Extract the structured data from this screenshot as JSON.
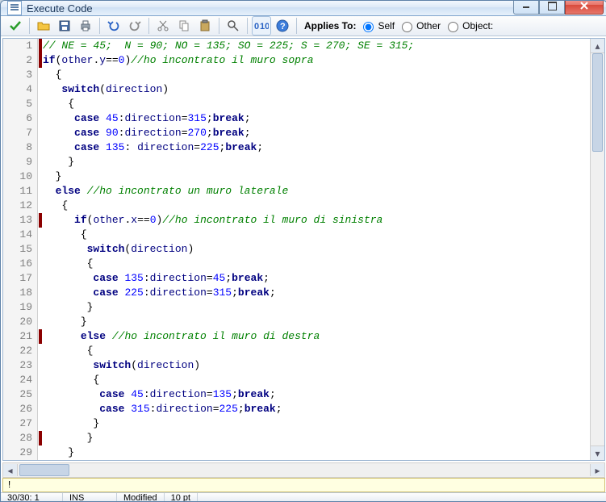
{
  "window": {
    "title": "Execute Code"
  },
  "toolbar": {
    "applies_label": "Applies To:",
    "opt_self": "Self",
    "opt_other": "Other",
    "opt_object": "Object:"
  },
  "applies_selected": "self",
  "code": {
    "lines": [
      {
        "n": 1,
        "mark": true,
        "html": "<span class='cm'>// NE = 45;  N = 90; NO = 135; SO = 225; S = 270; SE = 315;</span>"
      },
      {
        "n": 2,
        "mark": true,
        "html": "<span class='kw'>if</span><span class='op'>(</span><span class='var'>other</span>.<span class='var'>y</span>==<span class='num'>0</span><span class='op'>)</span><span class='cm'>//ho incontrato il muro sopra</span>"
      },
      {
        "n": 3,
        "mark": false,
        "html": "  <span class='op'>{</span>"
      },
      {
        "n": 4,
        "mark": false,
        "html": "   <span class='kw'>switch</span><span class='op'>(</span><span class='var'>direction</span><span class='op'>)</span>"
      },
      {
        "n": 5,
        "mark": false,
        "html": "    <span class='op'>{</span>"
      },
      {
        "n": 6,
        "mark": false,
        "html": "     <span class='kw'>case</span> <span class='num'>45</span>:<span class='var'>direction</span>=<span class='num'>315</span>;<span class='kw'>break</span>;"
      },
      {
        "n": 7,
        "mark": false,
        "html": "     <span class='kw'>case</span> <span class='num'>90</span>:<span class='var'>direction</span>=<span class='num'>270</span>;<span class='kw'>break</span>;"
      },
      {
        "n": 8,
        "mark": false,
        "html": "     <span class='kw'>case</span> <span class='num'>135</span>: <span class='var'>direction</span>=<span class='num'>225</span>;<span class='kw'>break</span>;"
      },
      {
        "n": 9,
        "mark": false,
        "html": "    <span class='op'>}</span>"
      },
      {
        "n": 10,
        "mark": false,
        "html": "  <span class='op'>}</span>"
      },
      {
        "n": 11,
        "mark": false,
        "html": "  <span class='kw'>else</span> <span class='cm'>//ho incontrato un muro laterale</span>"
      },
      {
        "n": 12,
        "mark": false,
        "html": "   <span class='op'>{</span>"
      },
      {
        "n": 13,
        "mark": true,
        "html": "     <span class='kw'>if</span><span class='op'>(</span><span class='var'>other</span>.<span class='var'>x</span>==<span class='num'>0</span><span class='op'>)</span><span class='cm'>//ho incontrato il muro di sinistra</span>"
      },
      {
        "n": 14,
        "mark": false,
        "html": "      <span class='op'>{</span>"
      },
      {
        "n": 15,
        "mark": false,
        "html": "       <span class='kw'>switch</span><span class='op'>(</span><span class='var'>direction</span><span class='op'>)</span>"
      },
      {
        "n": 16,
        "mark": false,
        "html": "       <span class='op'>{</span>"
      },
      {
        "n": 17,
        "mark": false,
        "html": "        <span class='kw'>case</span> <span class='num'>135</span>:<span class='var'>direction</span>=<span class='num'>45</span>;<span class='kw'>break</span>;"
      },
      {
        "n": 18,
        "mark": false,
        "html": "        <span class='kw'>case</span> <span class='num'>225</span>:<span class='var'>direction</span>=<span class='num'>315</span>;<span class='kw'>break</span>;"
      },
      {
        "n": 19,
        "mark": false,
        "html": "       <span class='op'>}</span>"
      },
      {
        "n": 20,
        "mark": false,
        "html": "      <span class='op'>}</span>"
      },
      {
        "n": 21,
        "mark": true,
        "html": "      <span class='kw'>else</span> <span class='cm'>//ho incontrato il muro di destra</span>"
      },
      {
        "n": 22,
        "mark": false,
        "html": "       <span class='op'>{</span>"
      },
      {
        "n": 23,
        "mark": false,
        "html": "        <span class='kw'>switch</span><span class='op'>(</span><span class='var'>direction</span><span class='op'>)</span>"
      },
      {
        "n": 24,
        "mark": false,
        "html": "        <span class='op'>{</span>"
      },
      {
        "n": 25,
        "mark": false,
        "html": "         <span class='kw'>case</span> <span class='num'>45</span>:<span class='var'>direction</span>=<span class='num'>135</span>;<span class='kw'>break</span>;"
      },
      {
        "n": 26,
        "mark": false,
        "html": "         <span class='kw'>case</span> <span class='num'>315</span>:<span class='var'>direction</span>=<span class='num'>225</span>;<span class='kw'>break</span>;"
      },
      {
        "n": 27,
        "mark": false,
        "html": "        <span class='op'>}</span>"
      },
      {
        "n": 28,
        "mark": true,
        "html": "       <span class='op'>}</span>"
      },
      {
        "n": 29,
        "mark": false,
        "html": "    <span class='op'>}</span>"
      }
    ]
  },
  "error_bar": "!",
  "status": {
    "pos": "30/30: 1",
    "ins": "INS",
    "mod": "Modified",
    "font": "10 pt"
  }
}
